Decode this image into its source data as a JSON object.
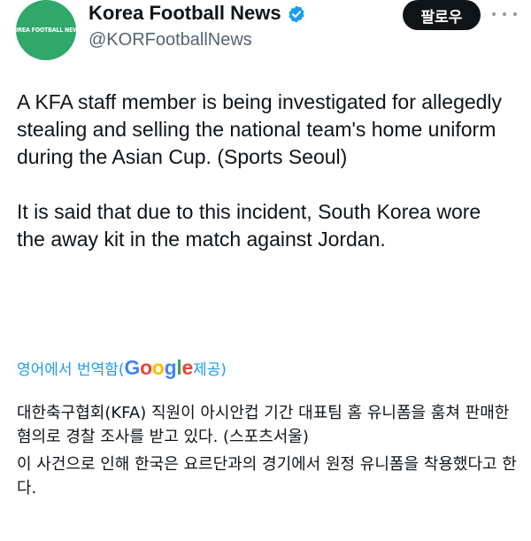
{
  "author": {
    "avatar_text": "KOREA FOOTBALL NEWS",
    "display_name": "Korea Football News",
    "handle": "@KORFootballNews",
    "verified": true
  },
  "actions": {
    "follow_label": "팔로우",
    "more_icon": "more-horizontal-icon"
  },
  "tweet": {
    "paragraphs": [
      "A KFA staff member is being investigated for allegedly stealing and selling the national team's home uniform during the Asian Cup. (Sports Seoul)",
      "It is said that due to this incident, South Korea wore the away kit in the match against Jordan."
    ]
  },
  "translation": {
    "prefix": "영어에서 번역함(",
    "provider": "Google",
    "suffix": " 제공)",
    "paragraphs": [
      "대한축구협회(KFA) 직원이 아시안컵 기간 대표팀 홈 유니폼을 훔쳐 판매한 혐의로 경찰 조사를 받고 있다. (스포츠서울)",
      "이 사건으로 인해 한국은 요르단과의 경기에서 원정 유니폼을 착용했다고 한다."
    ]
  },
  "colors": {
    "avatar_bg": "#2fa86a",
    "verified_blue": "#1d9bf0",
    "link_blue": "#1d9bf0",
    "follow_bg": "#0f1419"
  }
}
